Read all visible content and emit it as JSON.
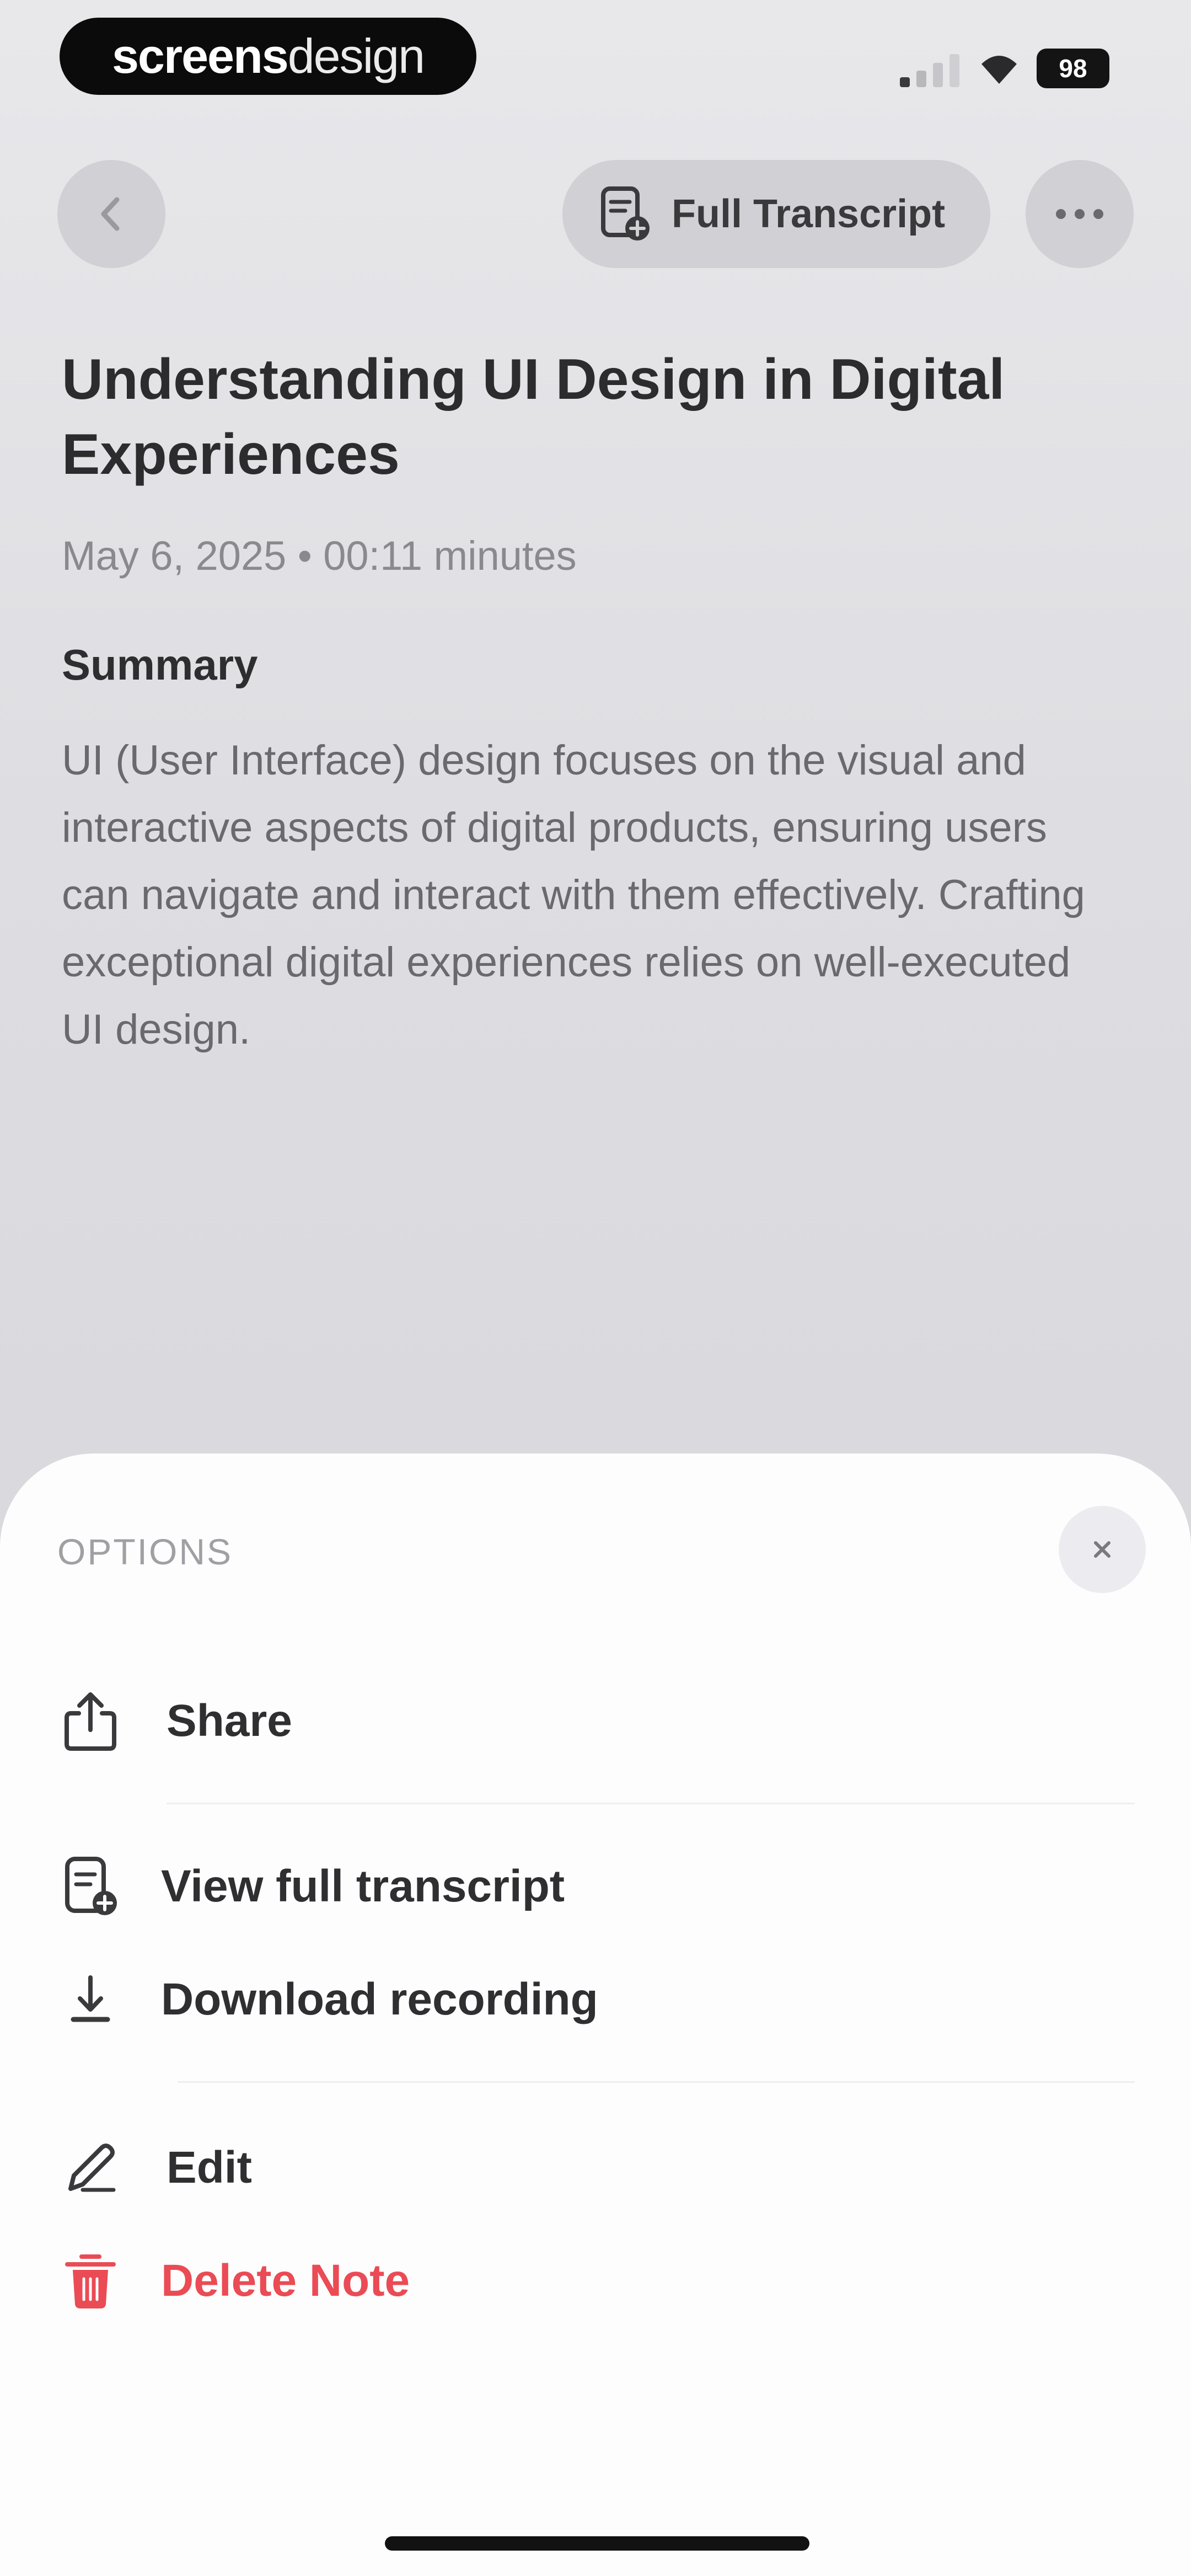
{
  "status_bar": {
    "brand_bold": "screens",
    "brand_light": "design",
    "battery": "98"
  },
  "nav": {
    "back_icon": "chevron-left-icon",
    "full_transcript_label": "Full Transcript",
    "more_icon": "ellipsis-icon"
  },
  "note": {
    "title": "Understanding UI Design in Digital Experiences",
    "meta": "May 6, 2025 • 00:11 minutes",
    "summary_heading": "Summary",
    "summary_text": "UI (User Interface) design focuses on the visual and interactive aspects of digital products, ensuring users can navigate and interact with them effectively. Crafting exceptional digital experiences relies on well-executed UI design."
  },
  "sheet": {
    "title": "OPTIONS",
    "items": [
      {
        "label": "Share",
        "icon": "share-icon"
      },
      {
        "label": "View full transcript",
        "icon": "transcript-icon"
      },
      {
        "label": "Download recording",
        "icon": "download-icon"
      },
      {
        "label": "Edit",
        "icon": "pencil-icon"
      },
      {
        "label": "Delete Note",
        "icon": "trash-icon"
      }
    ]
  },
  "colors": {
    "danger": "#ea4b55",
    "sheet_background": "#fdfdfd",
    "page_background": "#e2e2e6"
  }
}
